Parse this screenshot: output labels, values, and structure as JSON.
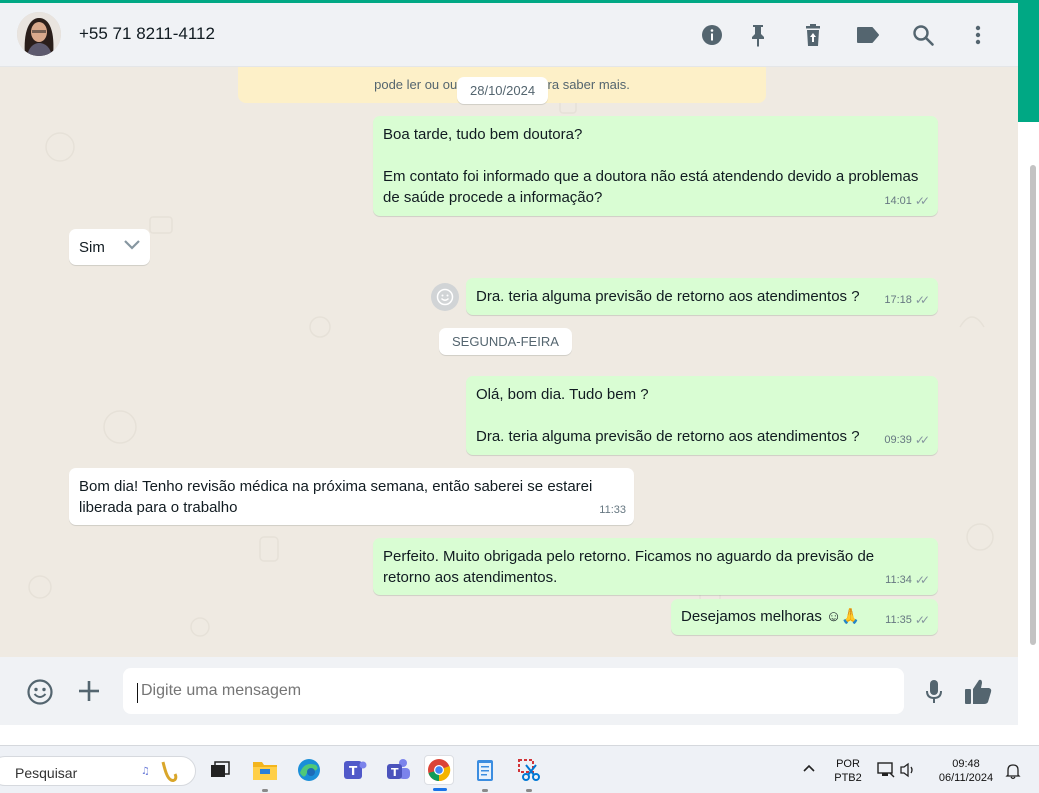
{
  "header": {
    "contact_name": "+55 71 8211-4112"
  },
  "system_note": {
    "line_fragment": "pode ler ou ou                         ra saber mais."
  },
  "dates": {
    "first": "28/10/2024",
    "second": "SEGUNDA-FEIRA"
  },
  "messages": [
    {
      "dir": "out",
      "text": "Boa tarde, tudo bem doutora?\n\nEm contato foi informado que a doutora não está atendendo devido a problemas de saúde procede a informação?",
      "time": "14:01"
    },
    {
      "dir": "in",
      "text": "Sim",
      "time": ""
    },
    {
      "dir": "out",
      "text": "Dra. teria alguma previsão de retorno aos atendimentos ?",
      "time": "17:18"
    },
    {
      "dir": "out",
      "text": "Olá, bom dia. Tudo bem ?\n\nDra. teria alguma previsão de retorno aos atendimentos ?",
      "time": "09:39"
    },
    {
      "dir": "in",
      "text": "Bom dia! Tenho revisão médica na próxima semana, então saberei se estarei liberada para o trabalho",
      "time": "11:33"
    },
    {
      "dir": "out",
      "text": "Perfeito. Muito obrigada pelo retorno. Ficamos no aguardo da previsão de retorno aos atendimentos.",
      "time": "11:34"
    },
    {
      "dir": "out",
      "text": "Desejamos melhoras ☺🙏",
      "time": "11:35"
    }
  ],
  "composer": {
    "placeholder": "Digite uma mensagem"
  },
  "taskbar": {
    "search_label": "Pesquisar",
    "lang_line1": "POR",
    "lang_line2": "PTB2",
    "clock_time": "09:48",
    "clock_date": "06/11/2024"
  },
  "colors": {
    "accent": "#00a884",
    "outgoing_bubble": "#d9fdd3",
    "incoming_bubble": "#ffffff",
    "chat_bg": "#efeae2"
  }
}
